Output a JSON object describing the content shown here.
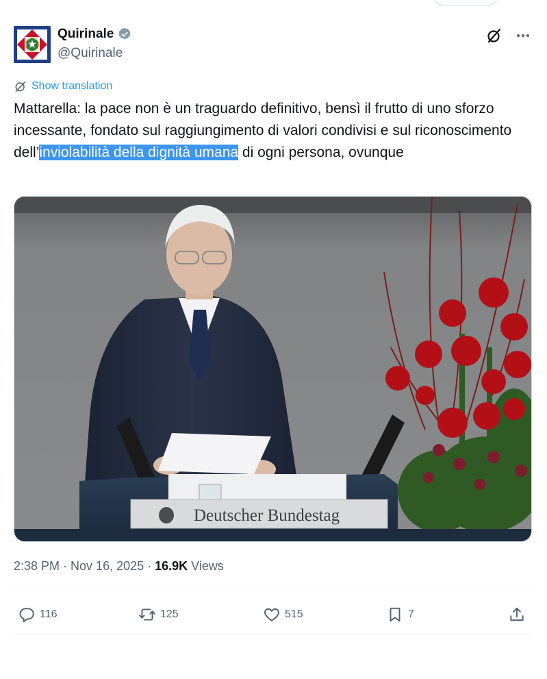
{
  "tweet": {
    "author": {
      "display_name": "Quirinale",
      "handle": "@Quirinale",
      "verified_icon": "verified-badge-icon",
      "avatar_colors": {
        "blue": "#1e3f84",
        "red": "#c8102e",
        "white": "#ffffff",
        "green": "#2a7a3b"
      }
    },
    "header_actions": [
      "grok-icon",
      "more-icon"
    ],
    "translation_label": "Show translation",
    "text_before": "Mattarella: la pace non è un traguardo definitivo, bensì il frutto di uno sforzo incessante, fondato sul raggiungimento di valori condivisi e sul riconoscimento dell’",
    "text_highlight": "inviolabilità della dignità umana",
    "text_after": " di ogni persona, ovunque",
    "media": {
      "podium_label": "Deutscher Bundestag"
    },
    "meta": {
      "time": "2:38 PM",
      "sep1": "·",
      "date": "Nov 16, 2025",
      "sep2": "·",
      "views_count": "16.9K",
      "views_label": "Views"
    },
    "actions": {
      "replies": "116",
      "reposts": "125",
      "likes": "515",
      "bookmarks": "7"
    },
    "colors": {
      "link": "#1d9bf0",
      "muted": "#536471",
      "highlight": "#3d95ed"
    }
  }
}
